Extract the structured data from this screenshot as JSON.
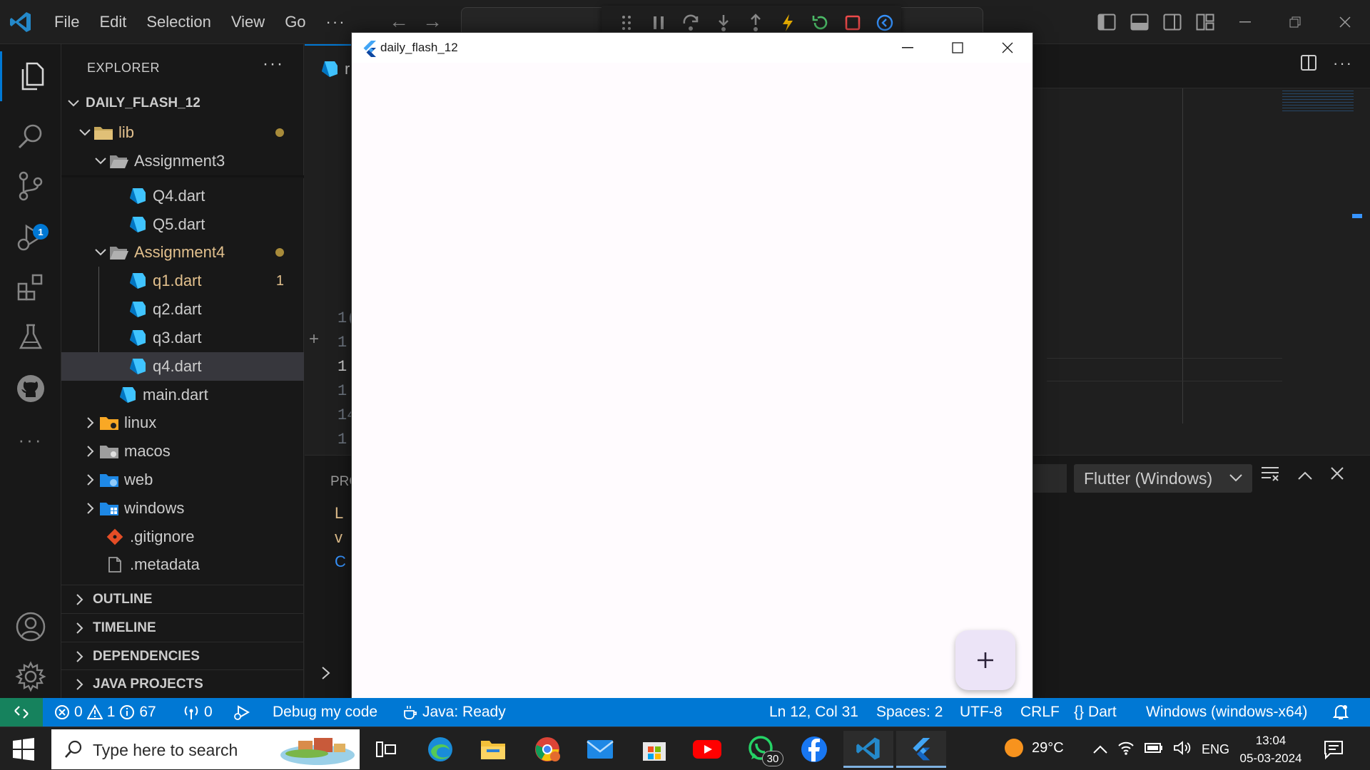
{
  "menu": {
    "file": "File",
    "edit": "Edit",
    "selection": "Selection",
    "view": "View",
    "go": "Go",
    "more": "···"
  },
  "activity": {
    "debug_badge": "1"
  },
  "sidebar": {
    "title": "EXPLORER",
    "more": "···",
    "root": "DAILY_FLASH_12",
    "tree": [
      {
        "label": "lib",
        "modified": true
      },
      {
        "label": "Assignment3",
        "modified": false
      },
      {
        "label": "Q4.dart",
        "modified": false
      },
      {
        "label": "Q5.dart",
        "modified": false
      },
      {
        "label": "Assignment4",
        "modified": true
      },
      {
        "label": "q1.dart",
        "modified": true,
        "count": "1"
      },
      {
        "label": "q2.dart",
        "modified": false
      },
      {
        "label": "q3.dart",
        "modified": false
      },
      {
        "label": "q4.dart",
        "modified": false,
        "selected": true
      },
      {
        "label": "main.dart",
        "modified": false
      },
      {
        "label": "linux",
        "modified": false
      },
      {
        "label": "macos",
        "modified": false
      },
      {
        "label": "web",
        "modified": false
      },
      {
        "label": "windows",
        "modified": false
      },
      {
        "label": ".gitignore",
        "modified": false
      },
      {
        "label": ".metadata",
        "modified": false
      }
    ],
    "sections": [
      "OUTLINE",
      "TIMELINE",
      "DEPENDENCIES",
      "JAVA PROJECTS"
    ]
  },
  "editor": {
    "tab_fragment": "r",
    "line_numbers": [
      "1(",
      "1",
      "1",
      "1",
      "14",
      "1"
    ],
    "panel": {
      "problems_fragment": "PRO",
      "output_select": "Flutter (Windows)",
      "lines": [
        "L",
        "v",
        "C"
      ]
    }
  },
  "flutter_window": {
    "title": "daily_flash_12",
    "fab_label": "+"
  },
  "statusbar": {
    "errors": "0",
    "warnings": "1",
    "infos": "67",
    "ports": "0",
    "debug_mode": "Debug my code",
    "java_status": "Java: Ready",
    "cursor": "Ln 12, Col 31",
    "indent": "Spaces: 2",
    "encoding": "UTF-8",
    "eol": "CRLF",
    "language": "Dart",
    "device": "Windows (windows-x64)"
  },
  "taskbar": {
    "search_placeholder": "Type here to search",
    "whatsapp_badge": "30",
    "temperature": "29°C",
    "language": "ENG",
    "time": "13:04",
    "date": "05-03-2024"
  },
  "colors": {
    "accent": "#0078d4",
    "remote": "#16825d",
    "modified": "#e2c08d",
    "flutter_bg": "#fffbfe",
    "fab_bg": "#ece4f7"
  }
}
